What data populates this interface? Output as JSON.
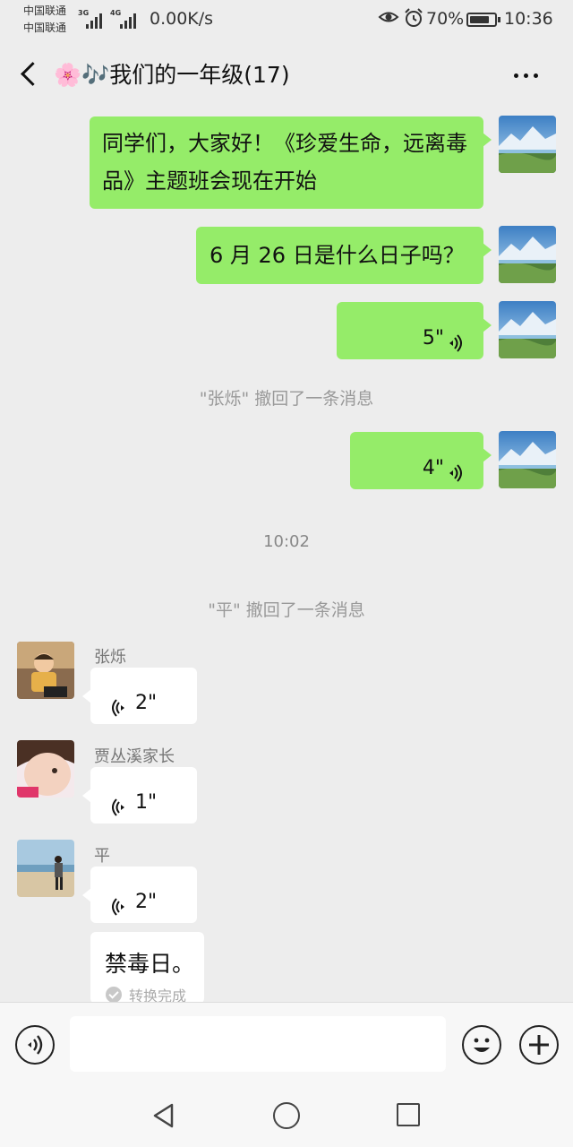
{
  "status_bar": {
    "carrier_1": "中国联通",
    "carrier_2": "中国联通",
    "net_1": "3G",
    "net_2": "4G",
    "speed": "0.00K/s",
    "battery": "70%",
    "battery_level": 0.7,
    "time": "10:36"
  },
  "header": {
    "title": "🌸🎶我们的一年级(17)"
  },
  "messages": [
    {
      "text": "同学们，大家好！《珍爱生命，远离毒品》主题班会现在开始"
    },
    {
      "text": "6 月 26 日是什么日子吗？"
    },
    {
      "duration": "5\""
    },
    {
      "system": "\"张烁\" 撤回了一条消息"
    },
    {
      "duration": "4\""
    },
    {
      "timestamp": "10:02"
    },
    {
      "system": "\"平\" 撤回了一条消息"
    },
    {
      "sender": "张烁",
      "duration": "2\""
    },
    {
      "sender": "贾丛溪家长",
      "duration": "1\""
    },
    {
      "sender": "平",
      "duration": "2\""
    },
    {
      "converted_text": "禁毒日。",
      "convert_status": "转换完成"
    }
  ],
  "input_bar": {
    "placeholder": ""
  }
}
